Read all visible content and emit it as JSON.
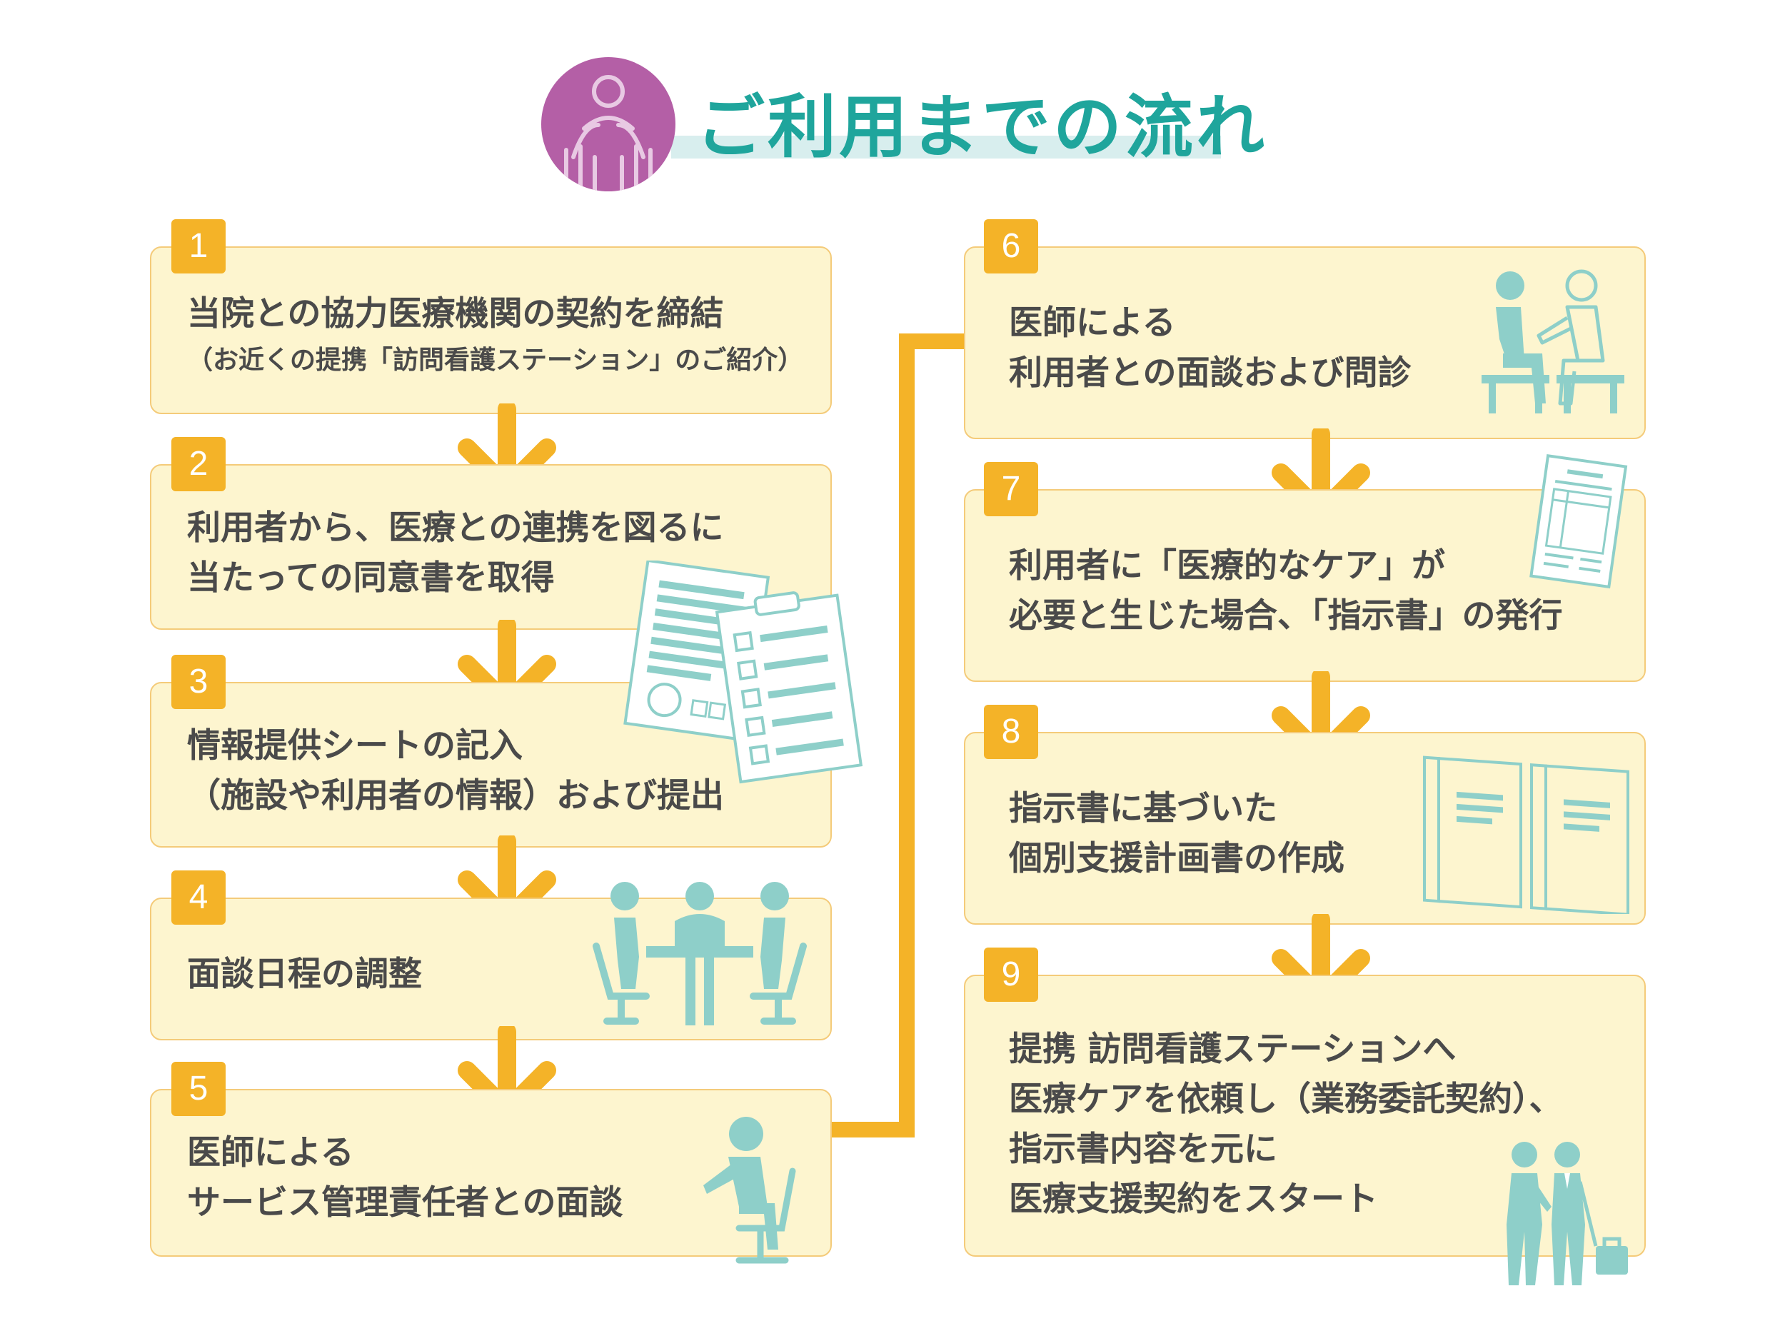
{
  "title": "ご利用までの流れ",
  "colors": {
    "accent": "#1fa59c",
    "badge": "#f4b328",
    "box_fill": "#fdf5cf",
    "box_border": "#f4cb7a",
    "icon": "#8ecfc9",
    "title_icon_bg": "#b45fa6"
  },
  "steps": [
    {
      "num": "1",
      "lines": [
        "当院との協力医療機関の契約を締結"
      ],
      "sub": "（お近くの提携「訪問看護ステーション」のご紹介）"
    },
    {
      "num": "2",
      "lines": [
        "利用者から、医療との連携を図るに",
        "当たっての同意書を取得"
      ]
    },
    {
      "num": "3",
      "lines": [
        "情報提供シートの記入",
        "（施設や利用者の情報）および提出"
      ]
    },
    {
      "num": "4",
      "lines": [
        "面談日程の調整"
      ]
    },
    {
      "num": "5",
      "lines": [
        "医師による",
        "サービス管理責任者との面談"
      ]
    },
    {
      "num": "6",
      "lines": [
        "医師による",
        "利用者との面談および問診"
      ]
    },
    {
      "num": "7",
      "lines": [
        "利用者に「医療的なケア」が",
        "必要と生じた場合、「指示書」の発行"
      ]
    },
    {
      "num": "8",
      "lines": [
        "指示書に基づいた",
        "個別支援計画書の作成"
      ]
    },
    {
      "num": "9",
      "lines": [
        "提携 訪問看護ステーションへ",
        "医療ケアを依頼し（業務委託契約）、",
        "指示書内容を元に",
        "医療支援契約をスタート"
      ]
    }
  ]
}
